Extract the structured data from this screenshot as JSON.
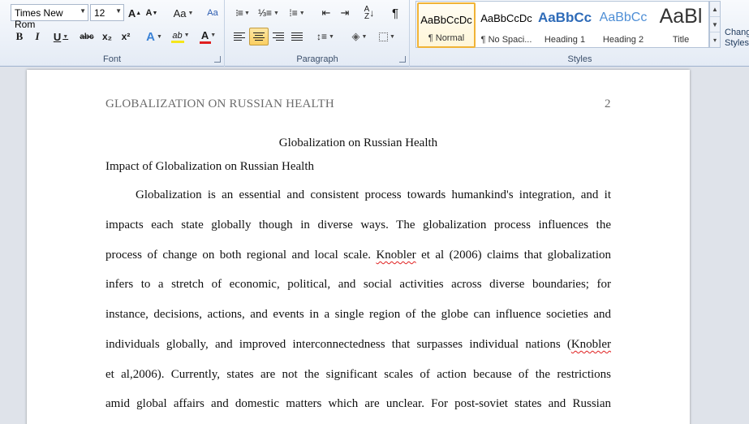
{
  "font_group": {
    "label": "Font",
    "font_name": "Times New Rom",
    "font_size": "12",
    "grow_font": "A",
    "shrink_font": "A",
    "change_case": "Aa",
    "bold": "B",
    "italic": "I",
    "underline": "U",
    "strikethrough": "abc",
    "subscript": "x₂",
    "superscript": "x²",
    "text_effects": "A",
    "highlight": "ab",
    "font_color": "A",
    "font_color_value": "#e02020",
    "highlight_color_value": "#f5e61c"
  },
  "paragraph_group": {
    "label": "Paragraph",
    "pilcrow": "¶"
  },
  "styles_group": {
    "label": "Styles",
    "styles": [
      {
        "sample": "AaBbCcDc",
        "name": "¶ Normal",
        "selected": true
      },
      {
        "sample": "AaBbCcDc",
        "name": "¶ No Spaci...",
        "selected": false
      },
      {
        "sample": "AaBbCc",
        "name": "Heading 1",
        "selected": false
      },
      {
        "sample": "AaBbCc",
        "name": "Heading 2",
        "selected": false
      },
      {
        "sample": "AaBl",
        "name": "Title",
        "selected": false
      }
    ],
    "change_styles": [
      "Change",
      "Styles"
    ]
  },
  "document": {
    "header_text": "GLOBALIZATION ON RUSSIAN HEALTH",
    "page_number": "2",
    "title": "Globalization on Russian Health",
    "heading": "Impact of Globalization on Russian Health",
    "lines": [
      "Globalization is an essential and consistent process towards humankind's integration, and it",
      "impacts each state globally though in diverse ways. The globalization process influences the",
      [
        "process of change on both regional and local scale. ",
        "Knobler",
        " et al (2006) claims that globalization"
      ],
      "infers to a stretch of economic, political, and social activities across diverse boundaries; for",
      "instance, decisions, actions, and events in a single region of the globe can influence societies and",
      [
        "individuals globally, and improved interconnectedness that surpasses individual nations (",
        "Knobler",
        ""
      ],
      "et al,2006). Currently, states are not the significant scales of action because of the restrictions",
      "amid global affairs and domestic matters which are unclear. For post-soviet states and Russian"
    ]
  }
}
